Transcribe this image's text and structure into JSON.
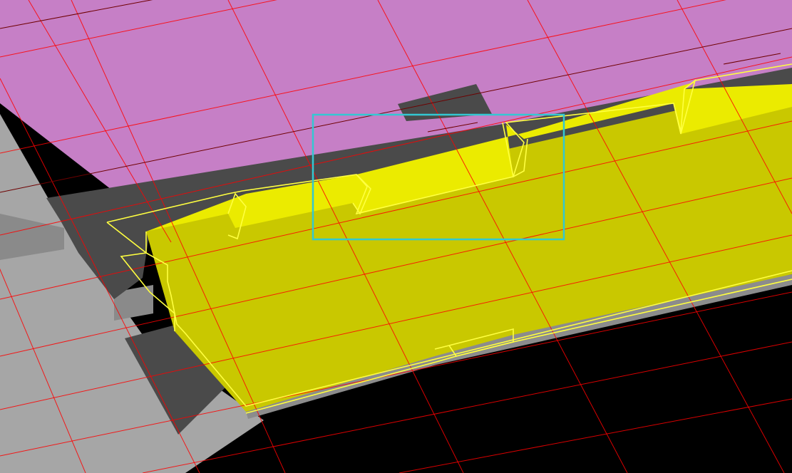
{
  "viewport": {
    "colors": {
      "background": "#000000",
      "pink_surface": "#c67fc6",
      "dark_gray_surface": "#4a4a4a",
      "light_gray_surface": "#a6a6a6",
      "yellow_top_face": "#ebeb00",
      "yellow_selected_face": "#c9c800",
      "yellow_outline": "#ffff40",
      "grid_red": "#ff0000",
      "grid_dark_red": "#6e0000",
      "selection_box": "#33c8d2"
    },
    "grid": {
      "visible": true
    },
    "selection_box": {
      "visible": true
    }
  }
}
